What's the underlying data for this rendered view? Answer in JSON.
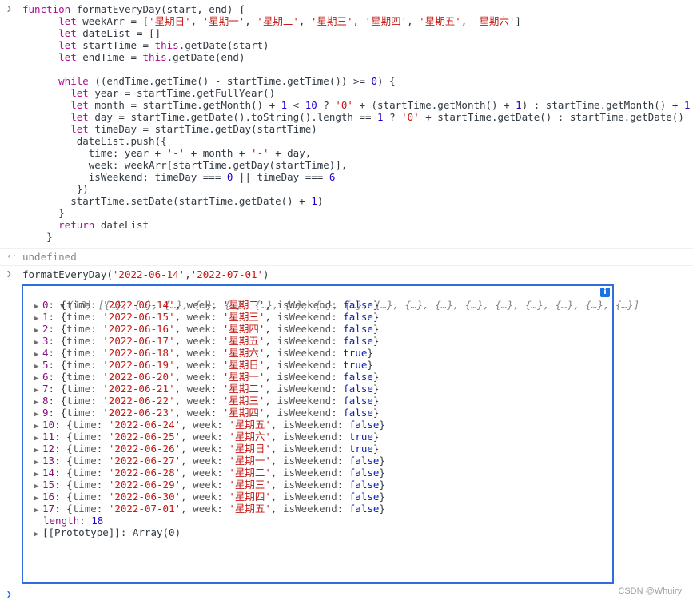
{
  "input_code": {
    "lines": [
      "function formatEveryDay(start, end) {",
      "      let weekArr = ['星期日', '星期一', '星期二', '星期三', '星期四', '星期五', '星期六']",
      "      let dateList = []",
      "      let startTime = this.getDate(start)",
      "      let endTime = this.getDate(end)",
      "",
      "      while ((endTime.getTime() - startTime.getTime()) >= 0) {",
      "        let year = startTime.getFullYear()",
      "        let month = startTime.getMonth() + 1 < 10 ? '0' + (startTime.getMonth() + 1) : startTime.getMonth() + 1",
      "        let day = startTime.getDate().toString().length == 1 ? '0' + startTime.getDate() : startTime.getDate()",
      "        let timeDay = startTime.getDay(startTime)",
      "         dateList.push({",
      "           time: year + '-' + month + '-' + day,",
      "           week: weekArr[startTime.getDay(startTime)],",
      "           isWeekend: timeDay === 0 || timeDay === 6",
      "         })",
      "        startTime.setDate(startTime.getDate() + 1)",
      "      }",
      "      return dateList",
      "    }"
    ]
  },
  "result_1": "undefined",
  "call_input": "formatEveryDay('2022-06-14','2022-07-01')",
  "array_summary": {
    "count_label": "(18)",
    "preview": "[{…}, {…}, {…}, {…}, {…}, {…}, {…}, {…}, {…}, {…}, {…}, {…}, {…}, {…}, {…}, {…}, {…}, {…}]"
  },
  "rows": [
    {
      "idx": "0",
      "time": "'2022-06-14'",
      "week": "'星期二'",
      "weekend": "false"
    },
    {
      "idx": "1",
      "time": "'2022-06-15'",
      "week": "'星期三'",
      "weekend": "false"
    },
    {
      "idx": "2",
      "time": "'2022-06-16'",
      "week": "'星期四'",
      "weekend": "false"
    },
    {
      "idx": "3",
      "time": "'2022-06-17'",
      "week": "'星期五'",
      "weekend": "false"
    },
    {
      "idx": "4",
      "time": "'2022-06-18'",
      "week": "'星期六'",
      "weekend": "true"
    },
    {
      "idx": "5",
      "time": "'2022-06-19'",
      "week": "'星期日'",
      "weekend": "true"
    },
    {
      "idx": "6",
      "time": "'2022-06-20'",
      "week": "'星期一'",
      "weekend": "false"
    },
    {
      "idx": "7",
      "time": "'2022-06-21'",
      "week": "'星期二'",
      "weekend": "false"
    },
    {
      "idx": "8",
      "time": "'2022-06-22'",
      "week": "'星期三'",
      "weekend": "false"
    },
    {
      "idx": "9",
      "time": "'2022-06-23'",
      "week": "'星期四'",
      "weekend": "false"
    },
    {
      "idx": "10",
      "time": "'2022-06-24'",
      "week": "'星期五'",
      "weekend": "false"
    },
    {
      "idx": "11",
      "time": "'2022-06-25'",
      "week": "'星期六'",
      "weekend": "true"
    },
    {
      "idx": "12",
      "time": "'2022-06-26'",
      "week": "'星期日'",
      "weekend": "true"
    },
    {
      "idx": "13",
      "time": "'2022-06-27'",
      "week": "'星期一'",
      "weekend": "false"
    },
    {
      "idx": "14",
      "time": "'2022-06-28'",
      "week": "'星期二'",
      "weekend": "false"
    },
    {
      "idx": "15",
      "time": "'2022-06-29'",
      "week": "'星期三'",
      "weekend": "false"
    },
    {
      "idx": "16",
      "time": "'2022-06-30'",
      "week": "'星期四'",
      "weekend": "false"
    },
    {
      "idx": "17",
      "time": "'2022-07-01'",
      "week": "'星期五'",
      "weekend": "false"
    }
  ],
  "length_label": "length",
  "length_value": "18",
  "prototype_label": "[[Prototype]]: Array(0)",
  "watermark": "CSDN @Whuiry",
  "colors": {
    "selection_border": "#2f6fdb",
    "info_icon": "#1a73e8"
  }
}
